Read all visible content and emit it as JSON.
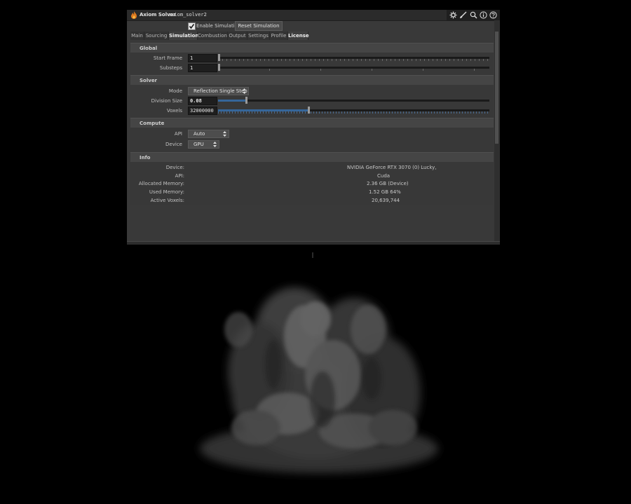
{
  "window": {
    "app_name": "Axiom Solver",
    "node_name": "axiom_solver2"
  },
  "toolbar": {
    "icons": [
      "gear-icon",
      "brush-icon",
      "search-icon",
      "info-icon",
      "help-icon"
    ],
    "enable_simulation_label": "Enable Simulation",
    "enable_simulation_checked": true,
    "reset_button_label": "Reset Simulation"
  },
  "tabs": [
    {
      "label": "Main",
      "active": false
    },
    {
      "label": "Sourcing",
      "active": false
    },
    {
      "label": "Simulation",
      "active": true
    },
    {
      "label": "Combustion",
      "active": false
    },
    {
      "label": "Output",
      "active": false
    },
    {
      "label": "Settings",
      "active": false
    },
    {
      "label": "Profile",
      "active": false
    },
    {
      "label": "License",
      "active": false
    }
  ],
  "global": {
    "title": "Global",
    "start_frame_label": "Start Frame",
    "start_frame_value": "1",
    "substeps_label": "Substeps",
    "substeps_value": "1"
  },
  "solver": {
    "title": "Solver",
    "mode_label": "Mode",
    "mode_value": "Reflection Single Step",
    "division_size_label": "Division Size",
    "division_size_value": "0.08",
    "division_size_fraction": 0.1,
    "voxels_label": "Voxels",
    "voxels_value": "32000000",
    "voxels_fraction": 0.33
  },
  "compute": {
    "title": "Compute",
    "api_label": "API",
    "api_value": "Auto",
    "device_label": "Device",
    "device_value": "GPU"
  },
  "info": {
    "title": "Info",
    "rows": [
      {
        "label": "Device:",
        "value": "NVIDIA GeForce RTX 3070 (0)   Lucky,"
      },
      {
        "label": "API:",
        "value": "Cuda"
      },
      {
        "label": "Allocated Memory:",
        "value": "2.36 GB (Device)"
      },
      {
        "label": "Used Memory:",
        "value": "1.52 GB    64%"
      },
      {
        "label": "Active Voxels:",
        "value": "20,639,744"
      }
    ]
  },
  "colors": {
    "accent": "#35669a",
    "panel_bg": "#393939",
    "viewport_bg": "#000000"
  }
}
